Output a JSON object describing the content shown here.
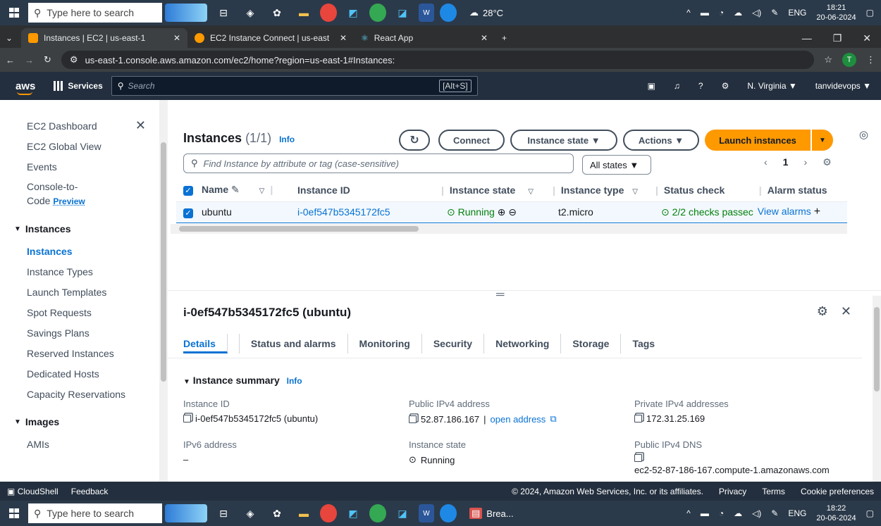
{
  "taskbar_top": {
    "search_placeholder": "Type here to search",
    "weather": "28°C",
    "lang": "ENG",
    "time": "18:21",
    "date": "20-06-2024"
  },
  "taskbar_bottom": {
    "search_placeholder": "Type here to search",
    "app_label": "Brea...",
    "lang": "ENG",
    "time": "18:22",
    "date": "20-06-2024"
  },
  "browser": {
    "tabs": [
      {
        "label": "Instances | EC2 | us-east-1"
      },
      {
        "label": "EC2 Instance Connect | us-east"
      },
      {
        "label": "React App"
      }
    ],
    "url": "us-east-1.console.aws.amazon.com/ec2/home?region=us-east-1#Instances:",
    "avatar": "T"
  },
  "awsnav": {
    "logo": "aws",
    "services": "Services",
    "search_placeholder": "Search",
    "shortcut": "[Alt+S]",
    "region": "N. Virginia ▼",
    "account": "tanvidevops ▼"
  },
  "sidebar": {
    "dashboard": "EC2 Dashboard",
    "global_view": "EC2 Global View",
    "events": "Events",
    "console_to": "Console-to-",
    "code": "Code",
    "preview": "Preview",
    "section_instances": "Instances",
    "items_instances": [
      "Instances",
      "Instance Types",
      "Launch Templates",
      "Spot Requests",
      "Savings Plans",
      "Reserved Instances",
      "Dedicated Hosts",
      "Capacity Reservations"
    ],
    "section_images": "Images",
    "items_images": [
      "AMIs"
    ]
  },
  "main": {
    "title": "Instances",
    "count": "(1/1)",
    "info": "Info",
    "connect": "Connect",
    "instance_state_btn": "Instance state ▼",
    "actions_btn": "Actions ▼",
    "launch_btn": "Launch instances",
    "filter_placeholder": "Find Instance by attribute or tag (case-sensitive)",
    "all_states": "All states ▼",
    "page": "1",
    "columns": [
      "Name",
      "Instance ID",
      "Instance state",
      "Instance type",
      "Status check",
      "Alarm status"
    ],
    "row": {
      "name": "ubuntu",
      "id": "i-0ef547b5345172fc5",
      "state": "Running",
      "type": "t2.micro",
      "status": "2/2 checks passec",
      "alarm": "View alarms"
    }
  },
  "detail": {
    "title": "i-0ef547b5345172fc5 (ubuntu)",
    "tabs": [
      "Details",
      "Status and alarms",
      "Monitoring",
      "Security",
      "Networking",
      "Storage",
      "Tags"
    ],
    "summary": "Instance summary",
    "info": "Info",
    "instance_id_label": "Instance ID",
    "instance_id_value": "i-0ef547b5345172fc5 (ubuntu)",
    "public_ipv4_label": "Public IPv4 address",
    "public_ipv4_value": "52.87.186.167",
    "open_address": "open address",
    "private_ipv4_label": "Private IPv4 addresses",
    "private_ipv4_value": "172.31.25.169",
    "ipv6_label": "IPv6 address",
    "ipv6_value": "–",
    "state_label": "Instance state",
    "state_value": "Running",
    "dns_label": "Public IPv4 DNS",
    "dns_value": "ec2-52-87-186-167.compute-1.amazonaws.com"
  },
  "footer": {
    "cloudshell": "CloudShell",
    "feedback": "Feedback",
    "copyright": "© 2024, Amazon Web Services, Inc. or its affiliates.",
    "privacy": "Privacy",
    "terms": "Terms",
    "cookies": "Cookie preferences"
  },
  "colors": {
    "aws_nav": "#232f3e",
    "accent": "#0972d3",
    "launch": "#ff9900",
    "running": "#037f0c"
  }
}
